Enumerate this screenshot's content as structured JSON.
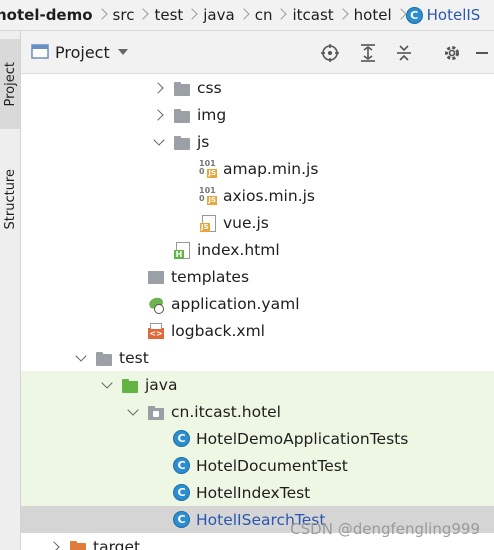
{
  "breadcrumb": [
    "hotel-demo",
    "src",
    "test",
    "java",
    "cn",
    "itcast",
    "hotel",
    "HotelIS"
  ],
  "stripe": {
    "project_tab": "Project",
    "structure_tab": "Structure"
  },
  "panel": {
    "title": "Project"
  },
  "tree": [
    {
      "label": "css",
      "icon": "folder",
      "expand": "r",
      "indent": 0,
      "bg": ""
    },
    {
      "label": "img",
      "icon": "folder",
      "expand": "r",
      "indent": 0,
      "bg": ""
    },
    {
      "label": "js",
      "icon": "folder",
      "expand": "d",
      "indent": 0,
      "bg": ""
    },
    {
      "label": "amap.min.js",
      "icon": "jsmin",
      "expand": "n",
      "indent": 1,
      "bg": ""
    },
    {
      "label": "axios.min.js",
      "icon": "jsmin",
      "expand": "n",
      "indent": 1,
      "bg": ""
    },
    {
      "label": "vue.js",
      "icon": "js",
      "expand": "n",
      "indent": 1,
      "bg": ""
    },
    {
      "label": "index.html",
      "icon": "html",
      "expand": "n",
      "indent": 0,
      "bg": ""
    },
    {
      "label": "templates",
      "icon": "tpl",
      "expand": "n",
      "indent": -1,
      "bg": ""
    },
    {
      "label": "application.yaml",
      "icon": "yaml",
      "expand": "n",
      "indent": -1,
      "bg": ""
    },
    {
      "label": "logback.xml",
      "icon": "xml",
      "expand": "n",
      "indent": -1,
      "bg": ""
    },
    {
      "label": "test",
      "icon": "folder",
      "expand": "d",
      "indent": -3,
      "bg": ""
    },
    {
      "label": "java",
      "icon": "folder-green",
      "expand": "d",
      "indent": -2,
      "bg": "test"
    },
    {
      "label": "cn.itcast.hotel",
      "icon": "pkg",
      "expand": "d",
      "indent": -1,
      "bg": "test"
    },
    {
      "label": "HotelDemoApplicationTests",
      "icon": "class",
      "expand": "n",
      "indent": 0,
      "bg": "test"
    },
    {
      "label": "HotelDocumentTest",
      "icon": "class",
      "expand": "n",
      "indent": 0,
      "bg": "test"
    },
    {
      "label": "HotelIndexTest",
      "icon": "class",
      "expand": "n",
      "indent": 0,
      "bg": "test"
    },
    {
      "label": "HotelISearchTest",
      "icon": "class",
      "expand": "n",
      "indent": 0,
      "bg": "sel"
    },
    {
      "label": "target",
      "icon": "folder-orange",
      "expand": "r",
      "indent": -4,
      "bg": ""
    }
  ],
  "watermark": "CSDN @dengfengling999"
}
